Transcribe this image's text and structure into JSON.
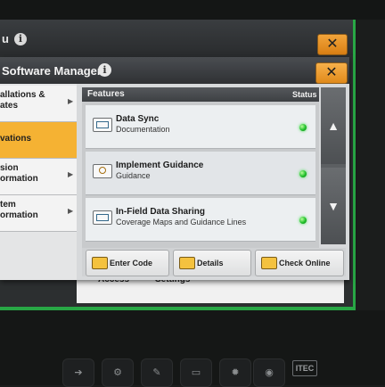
{
  "background_window": {
    "title_fragment": "u",
    "info_icon": "i",
    "close_icon": "✕",
    "bottom_labels": [
      "Access",
      "Settings"
    ]
  },
  "dialog": {
    "title": "Software Manager",
    "info_icon": "i",
    "close_icon": "✕"
  },
  "nav": {
    "items": [
      {
        "label": "allations &\nates",
        "active": false
      },
      {
        "label": "vations",
        "active": true
      },
      {
        "label": "sion\normation",
        "active": false
      },
      {
        "label": "tem\normation",
        "active": false
      }
    ]
  },
  "features_panel": {
    "header_left": "Features",
    "header_right": "Status",
    "rows": [
      {
        "name": "Data Sync",
        "sub": "Documentation",
        "icon": "display-icon",
        "status_color": "#1fbf2a"
      },
      {
        "name": "Implement Guidance",
        "sub": "Guidance",
        "icon": "guidance-icon",
        "status_color": "#1fbf2a"
      },
      {
        "name": "In-Field Data Sharing",
        "sub": "Coverage Maps and Guidance Lines",
        "icon": "display-icon",
        "status_color": "#1fbf2a"
      }
    ]
  },
  "scroll": {
    "up": "▲",
    "down": "▼"
  },
  "footer": {
    "enter_code": "Enter Code",
    "details": "Details",
    "check_online": "Check Online"
  },
  "hardware": {
    "itec": "ITEC"
  }
}
